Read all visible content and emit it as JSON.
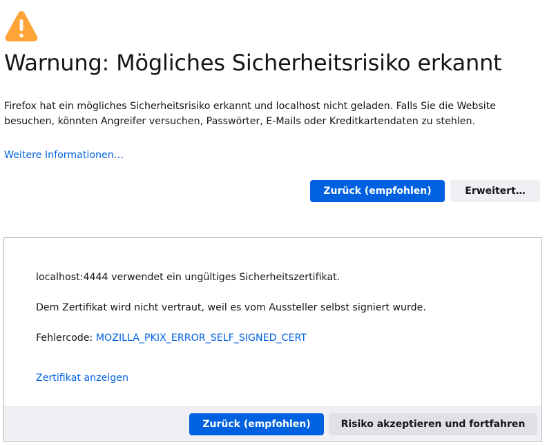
{
  "page": {
    "title": "Warnung: Mögliches Sicherheitsrisiko erkannt",
    "icon": "warning-triangle-icon",
    "intro": "Firefox hat ein mögliches Sicherheitsrisiko erkannt und localhost nicht geladen. Falls Sie die Website besuchen, könnten Angreifer versuchen, Passwörter, E-Mails oder Kreditkartendaten zu stehlen.",
    "learn_more": "Weitere Informationen…"
  },
  "actions": {
    "back_label": "Zurück (empfohlen)",
    "advanced_label": "Erweitert…"
  },
  "advanced": {
    "line1": "localhost:4444 verwendet ein ungültiges Sicherheitszertifikat.",
    "line2": "Dem Zertifikat wird nicht vertraut, weil es vom Aussteller selbst signiert wurde.",
    "error_code_label": "Fehlercode: ",
    "error_code": "MOZILLA_PKIX_ERROR_SELF_SIGNED_CERT",
    "view_certificate": "Zertifikat anzeigen",
    "back_label": "Zurück (empfohlen)",
    "accept_label": "Risiko akzeptieren und fortfahren"
  },
  "colors": {
    "accent": "#0061e0",
    "warning": "#ffa436",
    "text": "#15141a",
    "secondary_button": "#f0f0f4"
  }
}
